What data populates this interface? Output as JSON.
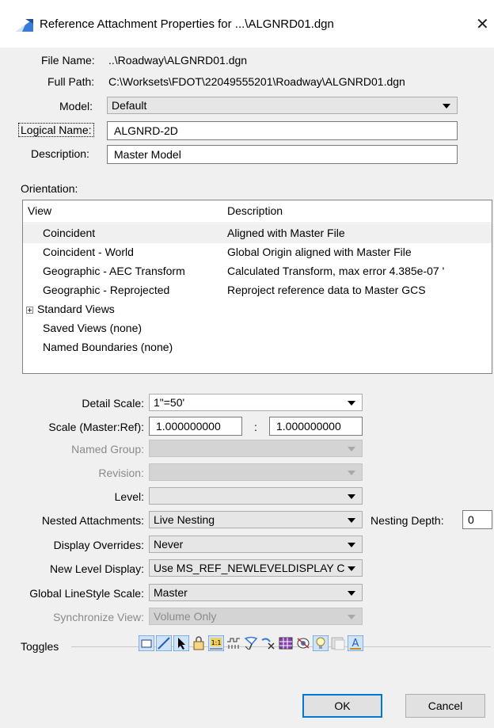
{
  "title": "Reference Attachment Properties for ...\\ALGNRD01.dgn",
  "fields": {
    "file_name_label": "File Name:",
    "file_name": "..\\Roadway\\ALGNRD01.dgn",
    "full_path_label": "Full Path:",
    "full_path": "C:\\Worksets\\FDOT\\22049555201\\Roadway\\ALGNRD01.dgn",
    "model_label": "Model:",
    "model": "Default",
    "logical_name_label": "Logical Name:",
    "logical_name": "ALGNRD-2D",
    "description_label": "Description:",
    "description": "Master Model"
  },
  "orientation": {
    "label": "Orientation:",
    "columns": [
      "View",
      "Description"
    ],
    "rows": [
      {
        "view": "Coincident",
        "description": "Aligned with Master File",
        "selected": true
      },
      {
        "view": "Coincident - World",
        "description": "Global Origin aligned with Master File"
      },
      {
        "view": "Geographic - AEC Transform",
        "description": "Calculated Transform, max error 4.385e-07 '"
      },
      {
        "view": "Geographic - Reprojected",
        "description": "Reproject reference data to Master GCS"
      },
      {
        "view": "Standard Views",
        "description": "",
        "expandable": true
      },
      {
        "view": "Saved Views (none)",
        "description": ""
      },
      {
        "view": "Named Boundaries (none)",
        "description": ""
      }
    ]
  },
  "settings": {
    "detail_scale_label": "Detail Scale:",
    "detail_scale": "1\"=50'",
    "scale_label": "Scale (Master:Ref):",
    "scale_master": "1.000000000",
    "scale_sep": ":",
    "scale_ref": "1.000000000",
    "named_group_label": "Named Group:",
    "named_group": "",
    "revision_label": "Revision:",
    "revision": "",
    "level_label": "Level:",
    "level": "",
    "nested_label": "Nested Attachments:",
    "nested": "Live Nesting",
    "nesting_depth_label": "Nesting Depth:",
    "nesting_depth": "0",
    "display_overrides_label": "Display Overrides:",
    "display_overrides": "Never",
    "new_level_label": "New Level Display:",
    "new_level": "Use MS_REF_NEWLEVELDISPLAY Cor",
    "linestyle_label": "Global LineStyle Scale:",
    "linestyle": "Master",
    "sync_label": "Synchronize View:",
    "sync": "Volume Only"
  },
  "toggles": {
    "label": "Toggles",
    "icons": [
      "display-icon",
      "snap-icon",
      "locate-icon",
      "lock-icon",
      "scale-lines-icon",
      "linestyle-icon",
      "treat-as-element-icon",
      "clip-icon",
      "raster-icon",
      "mask-icon",
      "lights-icon",
      "hidden-icon",
      "text-annotation-icon"
    ]
  },
  "buttons": {
    "ok": "OK",
    "cancel": "Cancel"
  },
  "colors": {
    "accent": "#0078d7",
    "dialog_bg": "#f0f0f0"
  }
}
